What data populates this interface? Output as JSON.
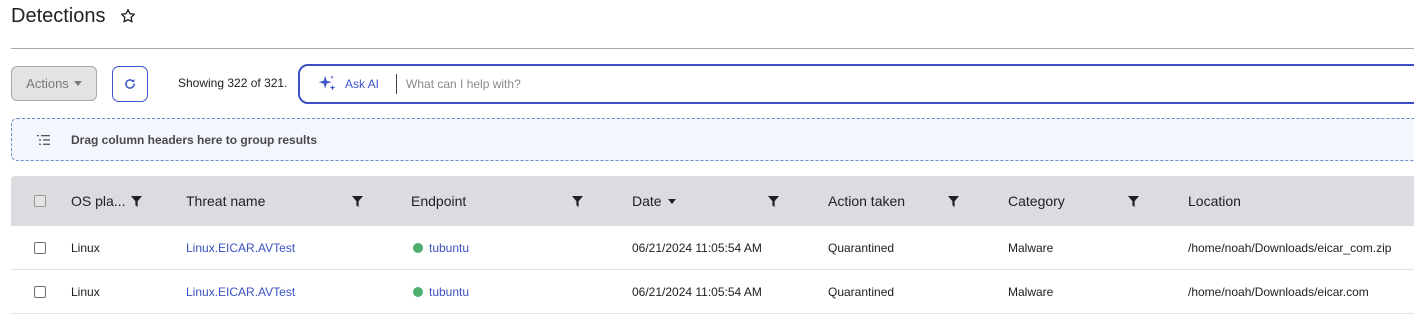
{
  "page": {
    "title": "Detections"
  },
  "toolbar": {
    "actions_label": "Actions",
    "showing_text": "Showing 322 of 321.",
    "ask_ai_label": "Ask AI",
    "ask_ai_placeholder": "What can I help with?"
  },
  "group_bar": {
    "text": "Drag column headers here to group results"
  },
  "table": {
    "columns": {
      "os_platform": "OS pla...",
      "threat_name": "Threat name",
      "endpoint": "Endpoint",
      "date": "Date",
      "action_taken": "Action taken",
      "category": "Category",
      "location": "Location"
    },
    "rows": [
      {
        "os_platform": "Linux",
        "threat_name": "Linux.EICAR.AVTest",
        "endpoint": "tubuntu",
        "date": "06/21/2024 11:05:54 AM",
        "action_taken": "Quarantined",
        "category": "Malware",
        "location": "/home/noah/Downloads/eicar_com.zip"
      },
      {
        "os_platform": "Linux",
        "threat_name": "Linux.EICAR.AVTest",
        "endpoint": "tubuntu",
        "date": "06/21/2024 11:05:54 AM",
        "action_taken": "Quarantined",
        "category": "Malware",
        "location": "/home/noah/Downloads/eicar.com"
      }
    ]
  },
  "colors": {
    "accent": "#3d55c9",
    "link": "#3b52c4",
    "header_bg": "#dadce0",
    "status_online": "#4caf6e",
    "group_bar_bg": "#f3f6fd"
  },
  "icons": [
    "star-icon",
    "refresh-icon",
    "sparkle-icon",
    "group-list-icon",
    "filter-icon",
    "sort-caret-icon",
    "status-dot-icon"
  ]
}
